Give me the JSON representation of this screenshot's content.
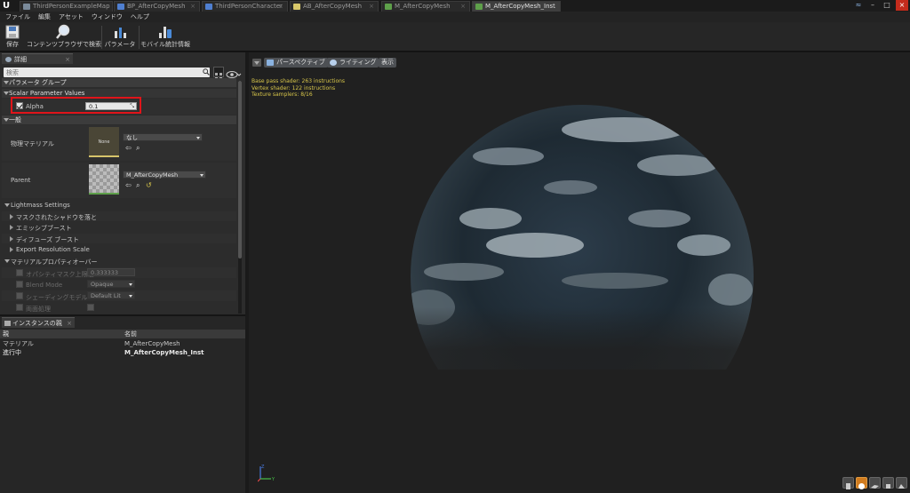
{
  "tabs": [
    {
      "label": "ThirdPersonExampleMap",
      "icon_color": "#7a8a9a",
      "active": false
    },
    {
      "label": "BP_AfterCopyMesh",
      "icon_color": "#4f7fd0",
      "active": false
    },
    {
      "label": "ThirdPersonCharacter",
      "icon_color": "#4f7fd0",
      "active": false
    },
    {
      "label": "AB_AfterCopyMesh",
      "icon_color": "#d8c86a",
      "active": false
    },
    {
      "label": "M_AfterCopyMesh",
      "icon_color": "#5ea04a",
      "active": false
    },
    {
      "label": "M_AfterCopyMesh_Inst",
      "icon_color": "#5ea04a",
      "active": true
    }
  ],
  "menu": [
    "ファイル",
    "編集",
    "アセット",
    "ウィンドウ",
    "ヘルプ"
  ],
  "toolbar": {
    "save": "保存",
    "find_in_cb": "コンテンツブラウザで検索",
    "params": "パラメータ",
    "mobile_stats": "モバイル統計情報"
  },
  "details": {
    "tab_label": "詳細",
    "search_placeholder": "検索",
    "param_group": "パラメータ グループ",
    "scalar_values": "Scalar Parameter Values",
    "alpha_label": "Alpha",
    "alpha_value": "0.1",
    "general": "一般",
    "phys_material": "物理マテリアル",
    "phys_thumb_label": "None",
    "phys_value": "なし",
    "parent": "Parent",
    "parent_value": "M_AfterCopyMesh",
    "lightmass": "Lightmass Settings",
    "masked_shadow": "マスクされたシャドウを落と",
    "emissive_boost": "エミッシブブースト",
    "diffuse_boost": "ディフューズ ブースト",
    "export_res": "Export Resolution Scale",
    "mat_prop_override": "マテリアルプロパティオーバー",
    "opacity_mask": "オパシティマスク上限値",
    "opacity_mask_value": "0.333333",
    "blend_mode": "Blend Mode",
    "blend_mode_value": "Opaque",
    "shading_model": "シェーディングモデル",
    "shading_model_value": "Default Lit",
    "two_sided": "両面処理"
  },
  "instance": {
    "tab_label": "インスタンスの親",
    "col_type": "親",
    "col_name": "名前",
    "rows": [
      {
        "type": "マテリアル",
        "name": "M_AfterCopyMesh"
      },
      {
        "type": "進行中",
        "name": "M_AfterCopyMesh_Inst"
      }
    ]
  },
  "viewport": {
    "perspective": "パースペクティブ",
    "lighting": "ライティング",
    "show": "表示",
    "stats": [
      "Base pass shader: 263 instructions",
      "Vertex shader: 122 instructions",
      "Texture samplers: 8/16"
    ]
  },
  "colors": {
    "highlight": "#e0141a",
    "stats_text": "#d8c64a"
  }
}
